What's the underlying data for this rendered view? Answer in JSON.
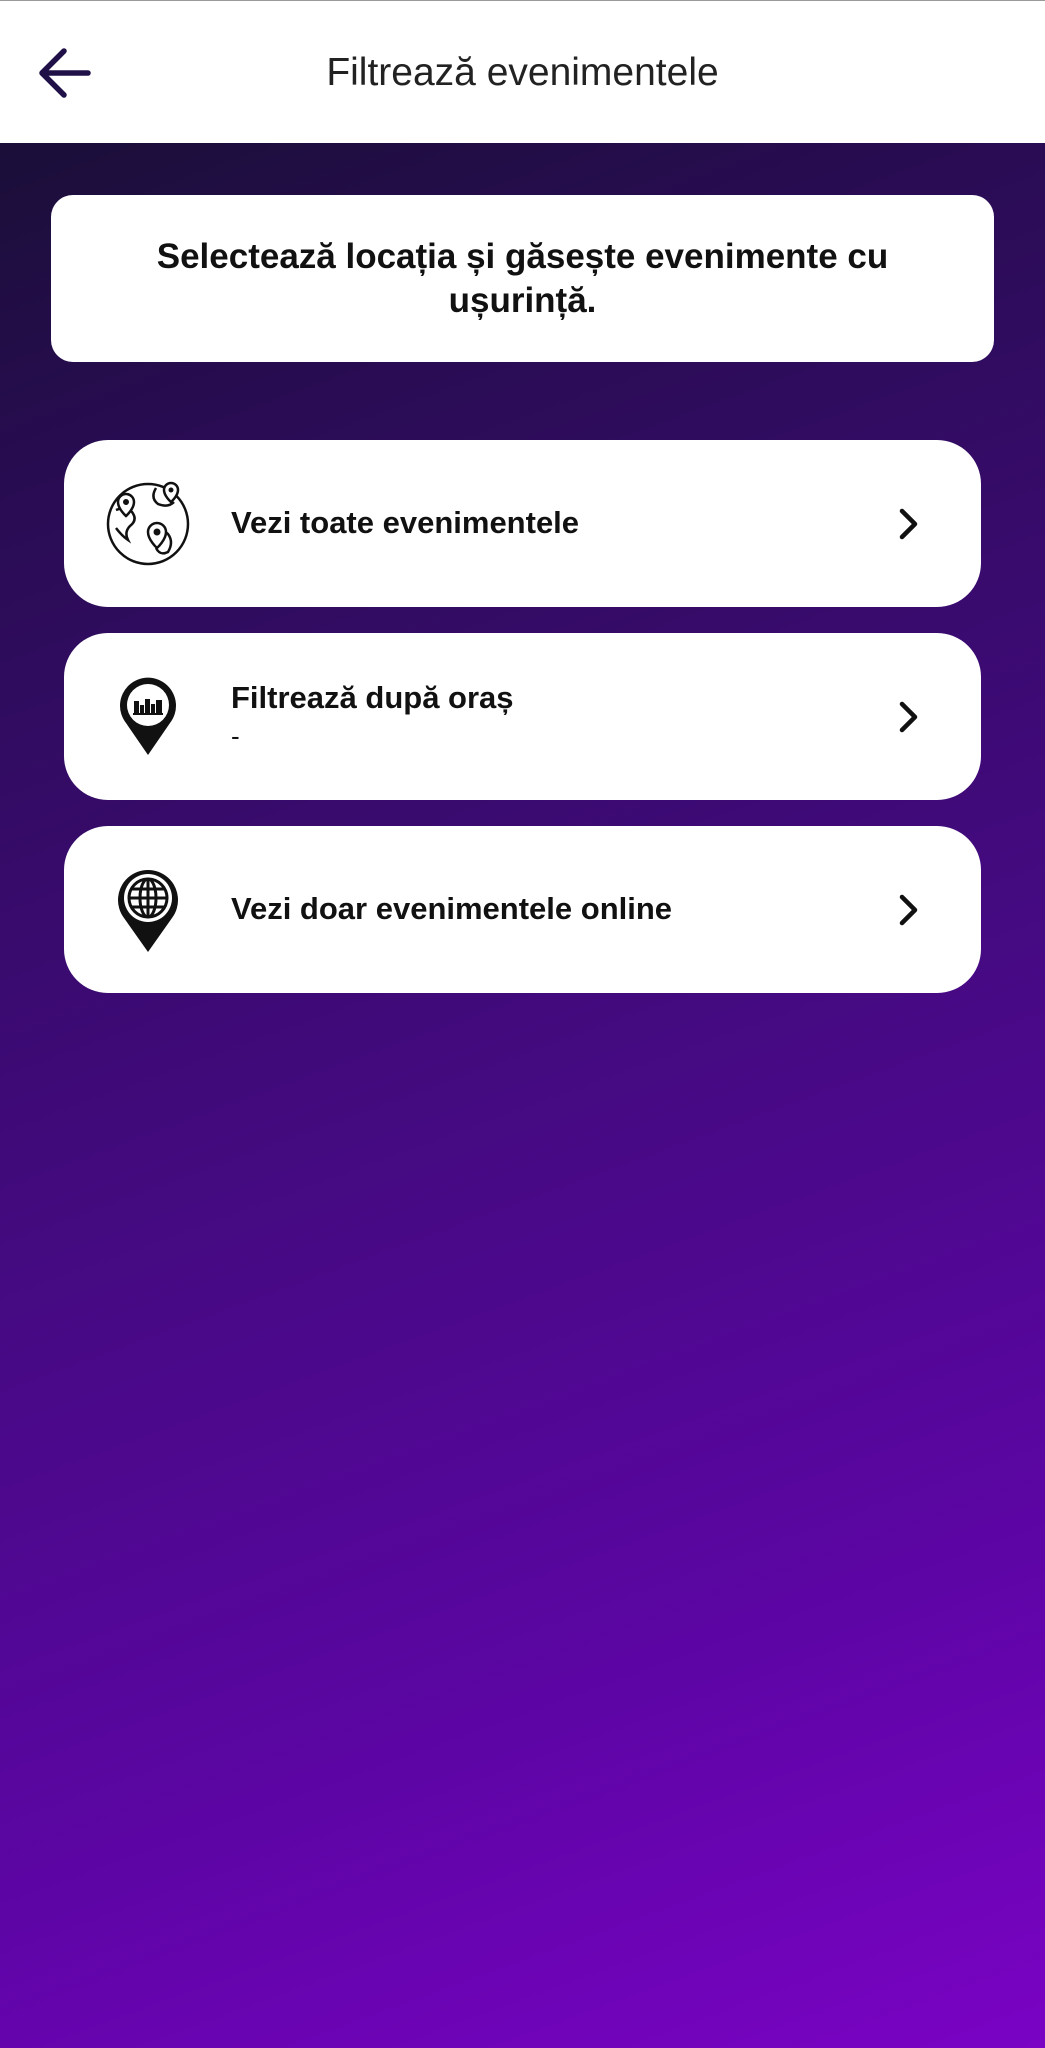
{
  "header": {
    "title": "Filtrează evenimentele",
    "back_icon": "arrow-left-icon"
  },
  "info": {
    "text": "Selectează locația și găsește evenimente cu ușurință."
  },
  "options": [
    {
      "label": "Vezi toate evenimentele",
      "icon": "globe-pins-icon"
    },
    {
      "label": "Filtrează după oraș",
      "value": "-",
      "icon": "city-pin-icon"
    },
    {
      "label": "Vezi doar evenimentele online",
      "icon": "globe-pin-icon"
    }
  ],
  "colors": {
    "accent_dark": "#1f1147",
    "gradient_start": "#150f2e",
    "gradient_end": "#7a03c4"
  }
}
